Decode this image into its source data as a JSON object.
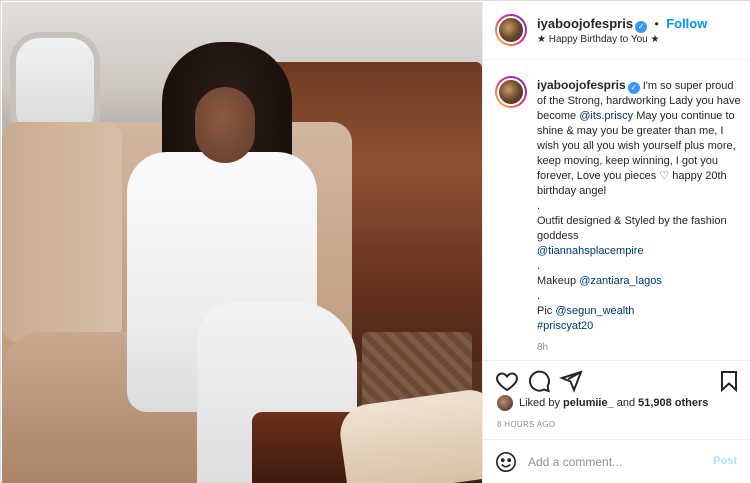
{
  "post": {
    "username": "iyaboojofespris",
    "follow_label": "Follow",
    "separator": "•",
    "subtitle": "★ Happy Birthday to You ★",
    "caption": {
      "username": "iyaboojofespris",
      "lines": [
        "I'm so super proud of the Strong, hardworking Lady you have become ",
        "@its.priscy",
        " May you continue to shine & may you be greater than me, I wish you all you wish yourself plus more, keep moving, keep winning, I got you forever, Love you pieces ",
        "♡",
        " happy 20th birthday angel"
      ],
      "dot1": ".",
      "outfit_text": "Outfit designed & Styled by the fashion goddess",
      "outfit_mention": "@tiannahsplacempire",
      "dot2": ".",
      "makeup_label": "Makeup ",
      "makeup_mention": "@zantiara_lagos",
      "dot3": ".",
      "pic_label": "Pic ",
      "pic_mention": "@segun_wealth",
      "hashtag": "#priscyat20"
    },
    "time_ago": "8h",
    "likes": {
      "prefix": "Liked by ",
      "user": "pelumiie_",
      "middle": " and ",
      "count": "51,908 others"
    },
    "posted_ago": "8 HOURS AGO",
    "comment_placeholder": "Add a comment...",
    "post_label": "Post"
  },
  "icons": {
    "verified": "verified-badge-icon",
    "like": "heart-icon",
    "comment": "comment-icon",
    "share": "share-icon",
    "save": "bookmark-icon",
    "emoji": "smiley-icon"
  },
  "colors": {
    "link": "#0095f6",
    "mention": "#00376b",
    "muted": "#8e8e8e",
    "post_disabled": "#b2dffc"
  }
}
